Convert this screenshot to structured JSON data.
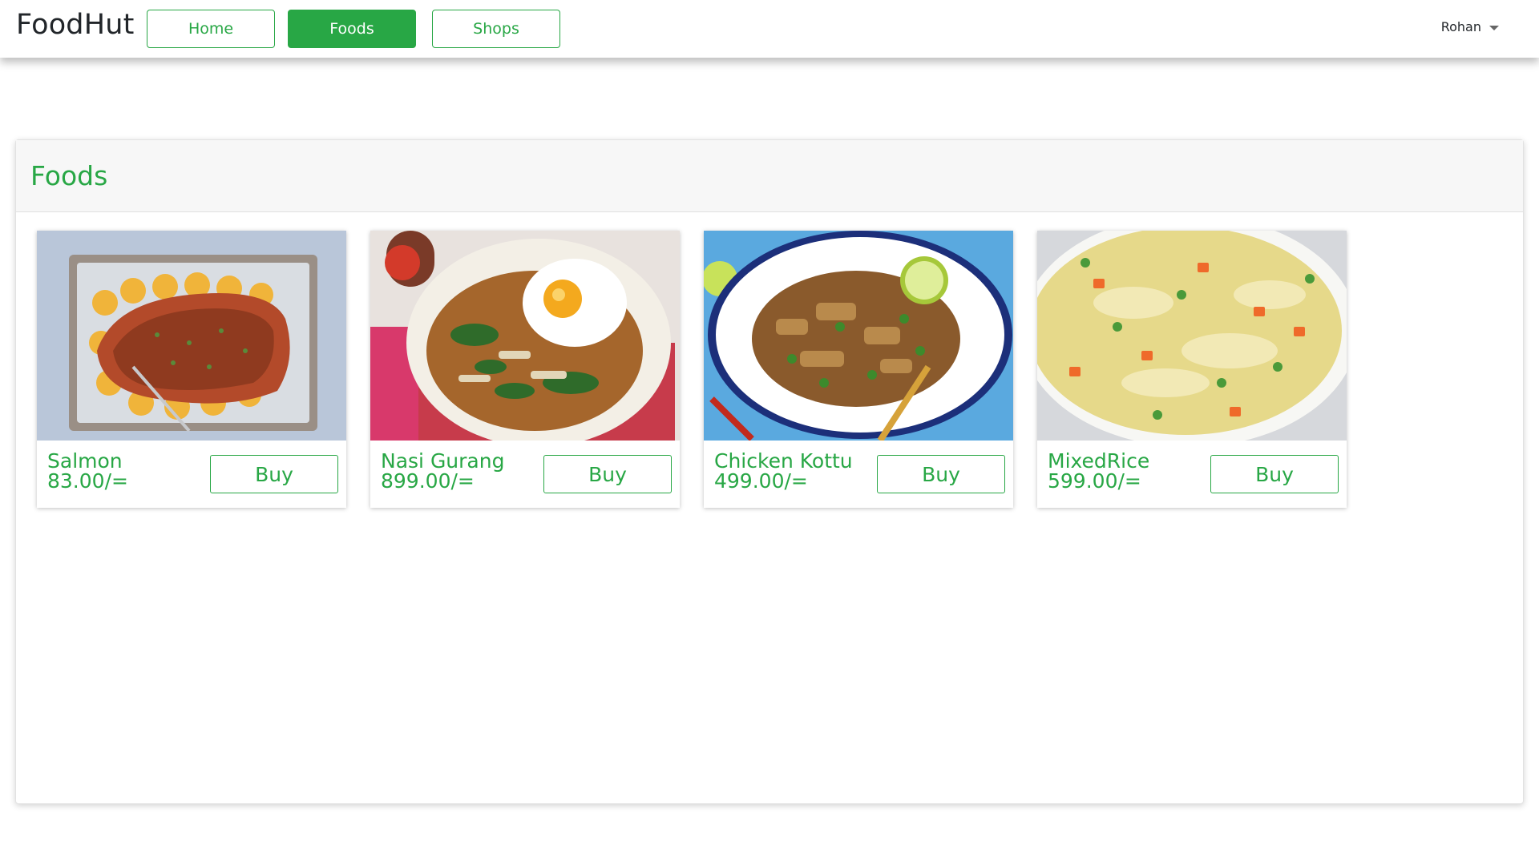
{
  "app": {
    "brand": "FoodHut"
  },
  "nav": {
    "home_label": "Home",
    "foods_label": "Foods",
    "shops_label": "Shops",
    "active": "Foods"
  },
  "user": {
    "name": "Rohan"
  },
  "panel": {
    "title": "Foods"
  },
  "foods": [
    {
      "name": "Salmon",
      "price": "83.00/=",
      "buy_label": "Buy",
      "image": "salmon-photo"
    },
    {
      "name": "Nasi Gurang",
      "price": "899.00/=",
      "buy_label": "Buy",
      "image": "nasi-goreng-photo"
    },
    {
      "name": "Chicken Kottu",
      "price": "499.00/=",
      "buy_label": "Buy",
      "image": "chicken-kottu-photo"
    },
    {
      "name": "MixedRice",
      "price": "599.00/=",
      "buy_label": "Buy",
      "image": "mixed-rice-photo"
    }
  ],
  "colors": {
    "accent": "#28a745",
    "panel_header_bg": "#f7f7f7"
  }
}
